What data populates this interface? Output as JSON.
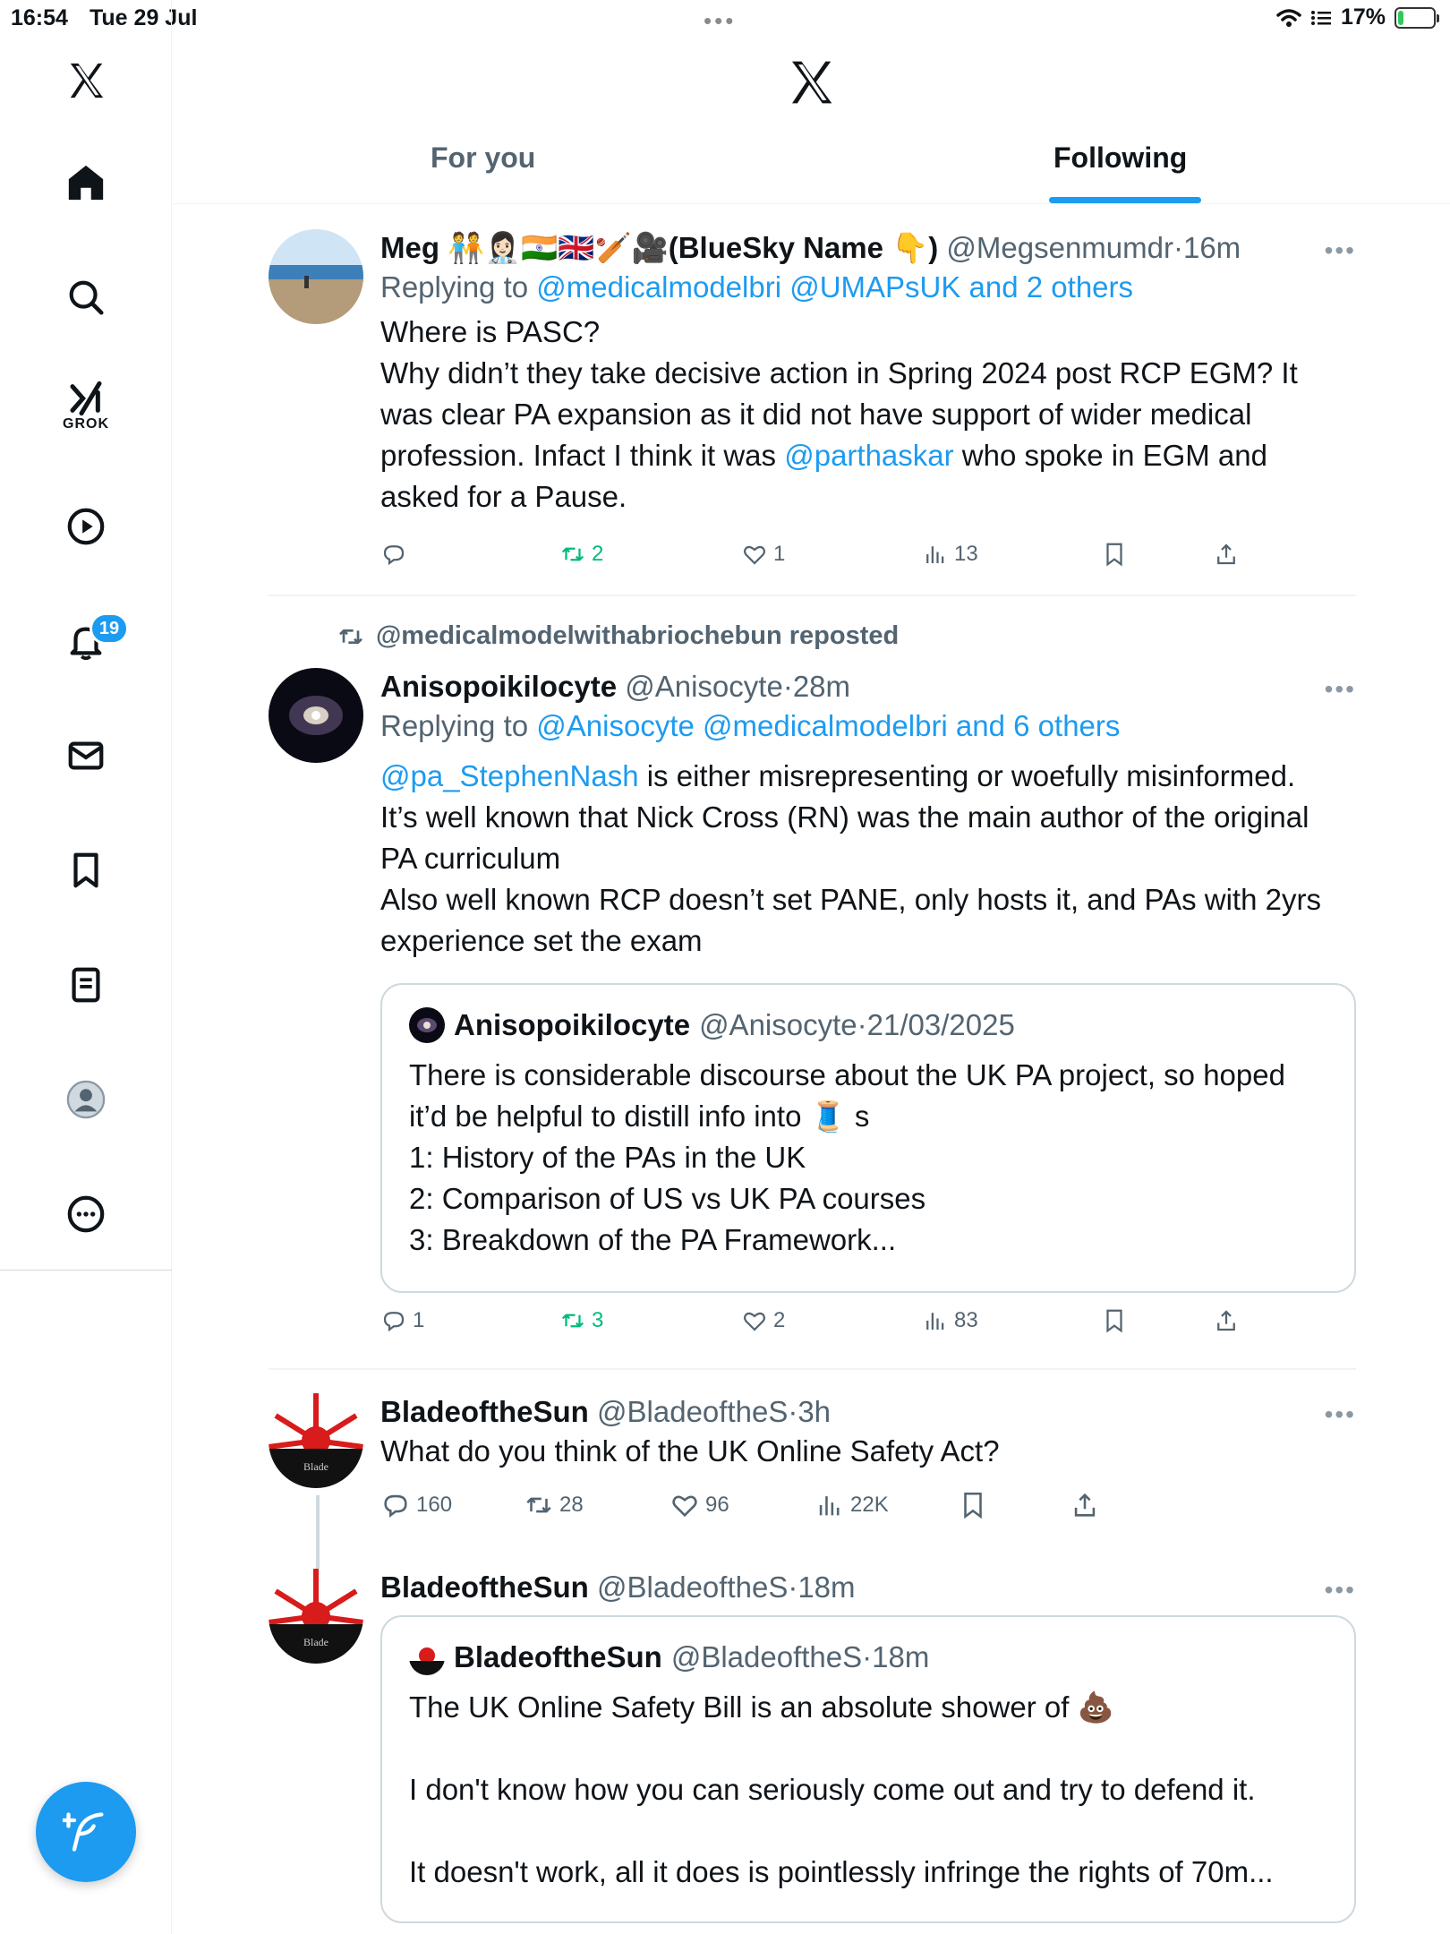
{
  "status": {
    "time": "16:54",
    "date": "Tue 29 Jul",
    "battery": "17%",
    "battery_level": 0.17
  },
  "sidebar": {
    "items": [
      {
        "name": "home"
      },
      {
        "name": "search"
      },
      {
        "name": "grok",
        "label": "GROK"
      },
      {
        "name": "video"
      },
      {
        "name": "notifications",
        "badge": "19"
      },
      {
        "name": "messages"
      },
      {
        "name": "bookmarks"
      },
      {
        "name": "lists"
      },
      {
        "name": "profile"
      },
      {
        "name": "more"
      }
    ]
  },
  "tabs": {
    "for_you": "For you",
    "following": "Following",
    "active": "Following"
  },
  "tweets": [
    {
      "name": "Meg 🧑‍🤝‍🧑👩🏻‍⚕️🇮🇳🇬🇧🏏🎥(BlueSky Name 👇)",
      "handle": "@Megsenmumdr",
      "time": "16m",
      "replying_prefix": "Replying to ",
      "replying_targets": "@medicalmodelbri @UMAPsUK and 2 others",
      "text_lines": [
        "Where is PASC?",
        "Why didn’t they take decisive action in Spring 2024 post RCP EGM? It",
        "was clear PA expansion as it did not have support of wider medical",
        "profession. Infact I think it was "
      ],
      "mention": "@parthaskar",
      "text_after_mention": " who spoke in EGM and",
      "text_last": "asked for a Pause.",
      "replies": "",
      "reposts": "2",
      "likes": "1",
      "views": "13"
    },
    {
      "reposted_by": "@medicalmodelwithabriochebun reposted",
      "name": "Anisopoikilocyte",
      "handle": "@Anisocyte",
      "time": "28m",
      "replying_prefix": "Replying to ",
      "replying_targets": "@Anisocyte @medicalmodelbri and 6 others",
      "mention": "@pa_StephenNash",
      "text_after_mention": " is either misrepresenting or woefully misinformed.",
      "text_lines": [
        "It’s well known that Nick Cross (RN) was the main author of the original",
        "PA curriculum",
        "Also well known RCP doesn’t set PANE, only hosts it, and PAs with 2yrs",
        "experience set the exam"
      ],
      "quote": {
        "name": "Anisopoikilocyte",
        "handle": "@Anisocyte",
        "time": "21/03/2025",
        "lines": [
          "There is considerable discourse about the UK PA project, so hoped",
          "it’d be helpful to distill info into 🧵 s",
          "1: History of the PAs in the UK",
          "2: Comparison of US vs UK PA courses",
          "3: Breakdown of the PA Framework..."
        ]
      },
      "replies": "1",
      "reposts": "3",
      "likes": "2",
      "views": "83"
    },
    {
      "name": "BladeoftheSun",
      "handle": "@BladeoftheS",
      "time": "3h",
      "text": "What do you think of the UK Online Safety Act?",
      "replies": "160",
      "reposts": "28",
      "likes": "96",
      "views": "22K"
    },
    {
      "name": "BladeoftheSun",
      "handle": "@BladeoftheS",
      "time": "18m",
      "quote": {
        "name": "BladeoftheSun",
        "handle": "@BladeoftheS",
        "time": "18m",
        "lines": [
          "The UK Online Safety Bill is an absolute shower of 💩",
          "",
          "I don't know how you can seriously come out and try to defend it.",
          "",
          "It doesn't work, all it does is pointlessly infringe the rights of 70m..."
        ]
      }
    }
  ],
  "colors": {
    "accent": "#1d9bf0",
    "repost_green": "#00ba7c",
    "muted": "#536471"
  }
}
